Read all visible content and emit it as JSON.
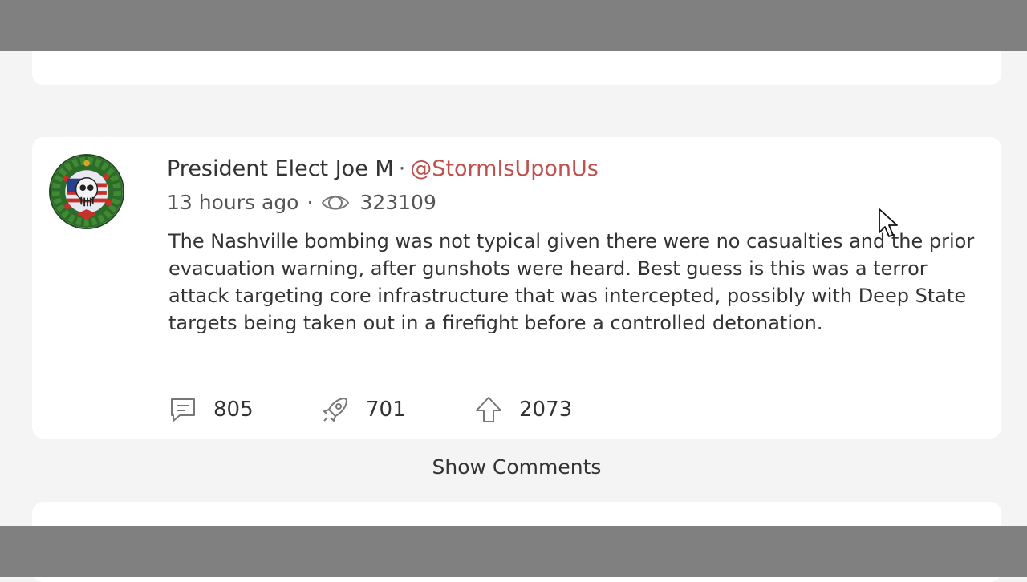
{
  "post": {
    "author_name": "President Elect Joe M",
    "separator": "·",
    "handle": "@StormIsUponUs",
    "timestamp": "13 hours ago",
    "views": "323109",
    "body": "The Nashville bombing was not typical given there were no casualties and the prior evacuation warning, after gunshots were heard. Best guess is this was a terror attack targeting core infrastructure that was intercepted, possibly with Deep State targets being taken out in a firefight before a controlled detonation.",
    "comment_count": "805",
    "share_count": "701",
    "upvote_count": "2073"
  },
  "show_comments_label": "Show Comments",
  "colors": {
    "handle": "#c0504d",
    "page_background": "#f4f4f4",
    "overlay_bars": "#808080"
  },
  "icons": {
    "views": "eye-icon",
    "comments": "comment-bubble-icon",
    "shares": "repost-rocket-icon",
    "upvotes": "upvote-arrow-icon"
  }
}
